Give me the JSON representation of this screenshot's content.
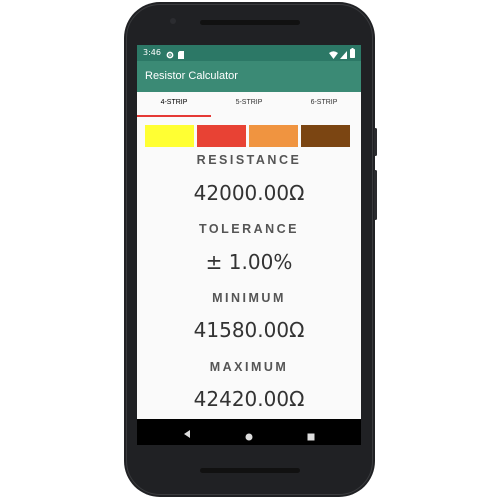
{
  "statusbar": {
    "time": "3:46"
  },
  "app": {
    "title": "Resistor Calculator"
  },
  "tabs": [
    {
      "label": "4-STRIP",
      "active": true
    },
    {
      "label": "5-STRIP",
      "active": false
    },
    {
      "label": "6-STRIP",
      "active": false
    }
  ],
  "bands": [
    {
      "name": "yellow",
      "color": "#ffff33"
    },
    {
      "name": "red",
      "color": "#e84234"
    },
    {
      "name": "orange",
      "color": "#f09440"
    },
    {
      "name": "brown",
      "color": "#7b4512"
    }
  ],
  "results": {
    "resistance_label": "RESISTANCE",
    "resistance_value": "42000.00Ω",
    "tolerance_label": "TOLERANCE",
    "tolerance_value": "± 1.00%",
    "minimum_label": "MINIMUM",
    "minimum_value": "41580.00Ω",
    "maximum_label": "MAXIMUM",
    "maximum_value": "42420.00Ω"
  },
  "colors": {
    "statusbar": "#2c7866",
    "appbar": "#3b8a75",
    "tab_indicator": "#e53935"
  },
  "icons": [
    "gear-icon",
    "sd-card-icon",
    "wifi-icon",
    "signal-icon",
    "battery-icon",
    "back-icon",
    "home-icon",
    "recents-icon"
  ]
}
